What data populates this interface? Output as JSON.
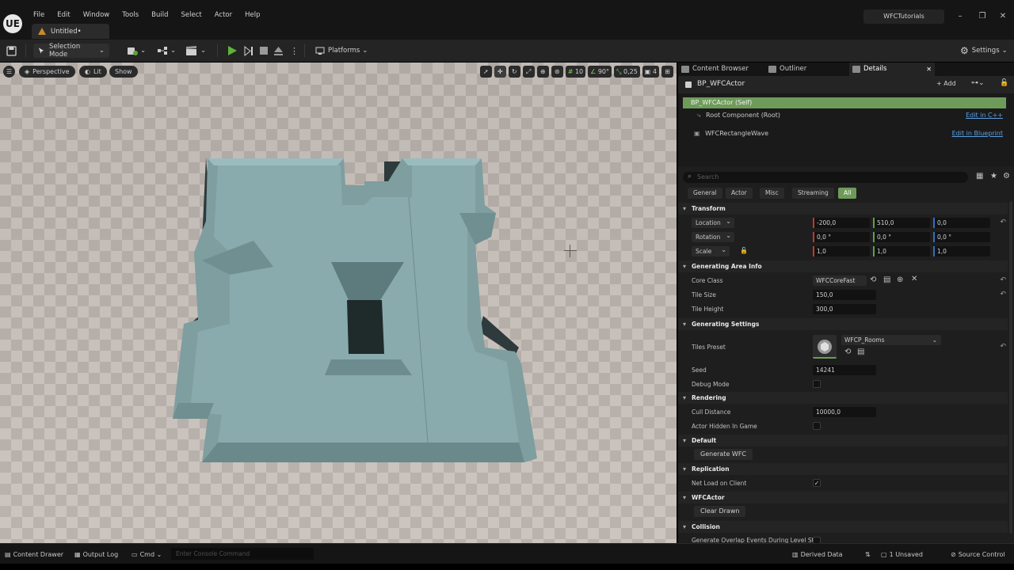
{
  "app": {
    "logo": "UE",
    "document_tab": "Untitled•",
    "project_name": "WFCTutorials"
  },
  "menu": [
    "File",
    "Edit",
    "Window",
    "Tools",
    "Build",
    "Select",
    "Actor",
    "Help"
  ],
  "window_controls": {
    "minimize": "–",
    "maximize": "❐",
    "close": "✕"
  },
  "toolbar": {
    "mode_label": "Selection Mode",
    "platforms_label": "Platforms",
    "settings_label": "Settings"
  },
  "viewport": {
    "perspective_label": "Perspective",
    "lit_label": "Lit",
    "show_label": "Show",
    "grid_snap": "10",
    "rotation_snap": "90°",
    "scale_snap": "0,25",
    "camera_speed": "4"
  },
  "panel_tabs": {
    "content_browser": "Content Browser",
    "outliner": "Outliner",
    "details": "Details",
    "close": "✕"
  },
  "details": {
    "actor_name": "BP_WFCActor",
    "add_label": "+ Add",
    "components": [
      {
        "label": "BP_WFCActor (Self)"
      },
      {
        "label": "Root Component (Root)",
        "link": "Edit in C++"
      },
      {
        "label": "WFCRectangleWave",
        "link": "Edit in Blueprint"
      }
    ],
    "search_placeholder": "Search",
    "filters": [
      "General",
      "Actor",
      "Misc",
      "Streaming",
      "All"
    ],
    "active_filter": "All",
    "sections": {
      "transform": "Transform",
      "generating_area": "Generating Area Info",
      "generating_settings": "Generating Settings",
      "rendering": "Rendering",
      "default": "Default",
      "replication": "Replication",
      "wfcactor": "WFCActor",
      "collision": "Collision"
    },
    "transform": {
      "location_label": "Location",
      "location": [
        "-200,0",
        "510,0",
        "0,0"
      ],
      "rotation_label": "Rotation",
      "rotation": [
        "0,0 °",
        "0,0 °",
        "0,0 °"
      ],
      "scale_label": "Scale",
      "scale": [
        "1,0",
        "1,0",
        "1,0"
      ]
    },
    "generating_area": {
      "core_class_label": "Core Class",
      "core_class_value": "WFCCoreFast",
      "tile_size_label": "Tile Size",
      "tile_size_value": "150,0",
      "tile_height_label": "Tile Height",
      "tile_height_value": "300,0"
    },
    "generating_settings": {
      "tiles_preset_label": "Tiles Preset",
      "tiles_preset_value": "WFCP_Rooms",
      "seed_label": "Seed",
      "seed_value": "14241",
      "debug_mode_label": "Debug Mode"
    },
    "rendering": {
      "cull_distance_label": "Cull Distance",
      "cull_distance_value": "10000,0",
      "actor_hidden_label": "Actor Hidden In Game"
    },
    "default": {
      "generate_button": "Generate WFC"
    },
    "replication": {
      "net_load_label": "Net Load on Client"
    },
    "wfcactor": {
      "clear_button": "Clear Drawn"
    },
    "collision": {
      "overlap_label": "Generate Overlap Events During Level St..."
    }
  },
  "statusbar": {
    "content_drawer": "Content Drawer",
    "output_log": "Output Log",
    "cmd": "Cmd",
    "console_placeholder": "Enter Console Command",
    "derived_data": "Derived Data",
    "unsaved": "1 Unsaved",
    "source_control": "Source Control"
  },
  "colors": {
    "accent_green": "#6e9b5a",
    "link_blue": "#5aa0e0",
    "mesh_color": "#7e9ea0",
    "axis_x": "#c0392b",
    "axis_y": "#5fa33a",
    "axis_z": "#2f6fc0"
  }
}
